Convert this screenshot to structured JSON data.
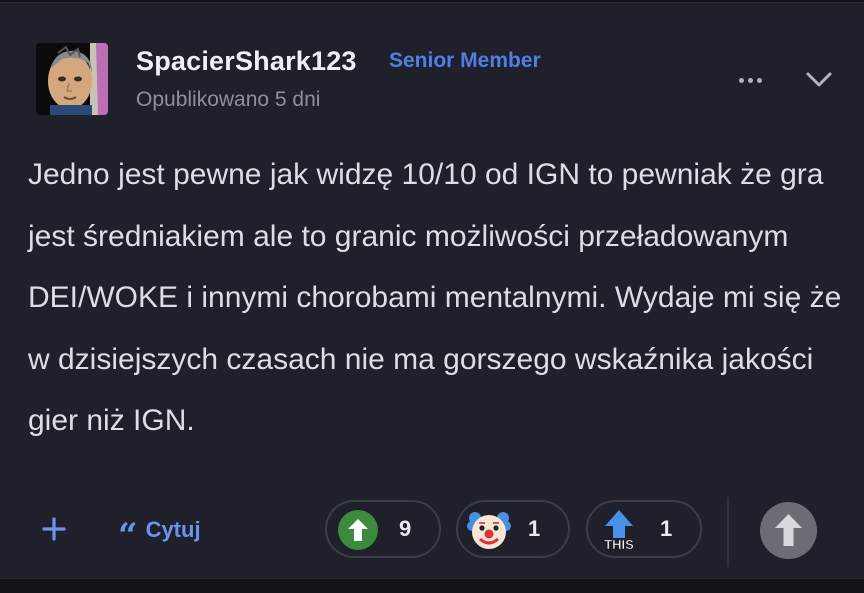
{
  "post": {
    "username": "SpacierShark123",
    "role": "Senior Member",
    "timestamp": "Opublikowano 5 dni",
    "body": "Jedno jest pewne jak widzę 10/10 od IGN to pewniak że gra jest średniakiem ale to granic możliwości przeładowanym DEI/WOKE i innymi chorobami mentalnymi. Wydaje mi się że w dzisiejszych czasach nie ma gorszego wskaźnika jakości gier niż IGN."
  },
  "actions": {
    "quote_label": "Cytuj",
    "reactions": [
      {
        "icon": "green-up-arrow-icon",
        "count": "9"
      },
      {
        "icon": "clown-face-icon",
        "count": "1"
      },
      {
        "icon": "this-arrow-icon",
        "label": "THIS",
        "count": "1"
      }
    ]
  },
  "colors": {
    "background": "#1f2029",
    "accent": "#4f7fe6",
    "upvote_green": "#3d8a3f"
  }
}
